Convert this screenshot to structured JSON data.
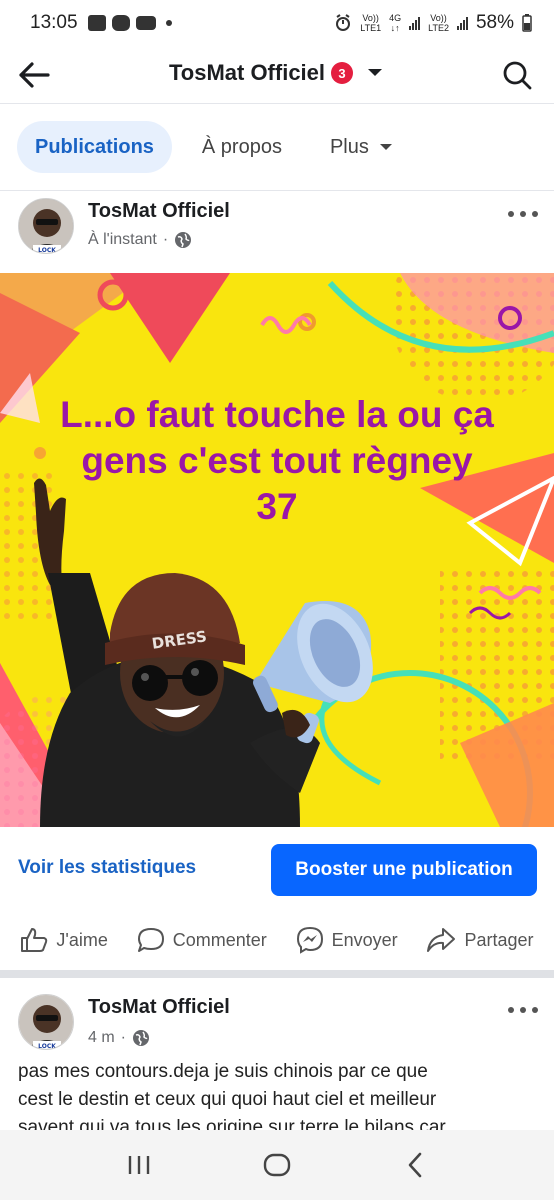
{
  "status_bar": {
    "time": "13:05",
    "net1_label": "Vo))",
    "net1_sub": "LTE1",
    "net_4g": "4G",
    "net2_label": "Vo))",
    "net2_sub": "LTE2",
    "battery": "58%",
    "icons": [
      "gallery-icon",
      "messenger-icon",
      "youtube-icon",
      "dot-icon",
      "alarm-icon",
      "signal-icon"
    ]
  },
  "header": {
    "title": "TosMat Officiel",
    "notification_count": "3",
    "icons": [
      "back-arrow-icon",
      "caret-down-icon",
      "search-icon"
    ]
  },
  "tabs": [
    {
      "label": "Publications",
      "active": true
    },
    {
      "label": "À propos",
      "active": false
    },
    {
      "label": "Plus",
      "active": false
    }
  ],
  "post1": {
    "author": "TosMat Officiel",
    "time": "À l'instant",
    "separator": "·",
    "image_text": [
      "L...o faut touche la ou ça",
      "gens c'est tout règney",
      "37"
    ],
    "image_hat_text": "DRESS",
    "stats_link": "Voir les statistiques",
    "boost_label": "Booster une publication",
    "actions": [
      {
        "label": "J'aime",
        "icon": "like-icon"
      },
      {
        "label": "Commenter",
        "icon": "comment-icon"
      },
      {
        "label": "Envoyer",
        "icon": "messenger-icon"
      },
      {
        "label": "Partager",
        "icon": "share-icon"
      }
    ]
  },
  "post2": {
    "author": "TosMat Officiel",
    "time": "4 m",
    "separator": "·",
    "text_lines": [
      "pas mes contours.deja je suis chinois par ce que",
      "cest le destin et ceux qui quoi haut ciel et meilleur",
      "savent qui va tous les origine sur terre le bilans car"
    ]
  },
  "colors": {
    "accent": "#0866ff",
    "link": "#1a63c4",
    "tab_active_bg": "#e7f0fd",
    "badge": "#e41e3f",
    "image_bg": "#f9e50e",
    "image_text": "#9a17a8"
  }
}
